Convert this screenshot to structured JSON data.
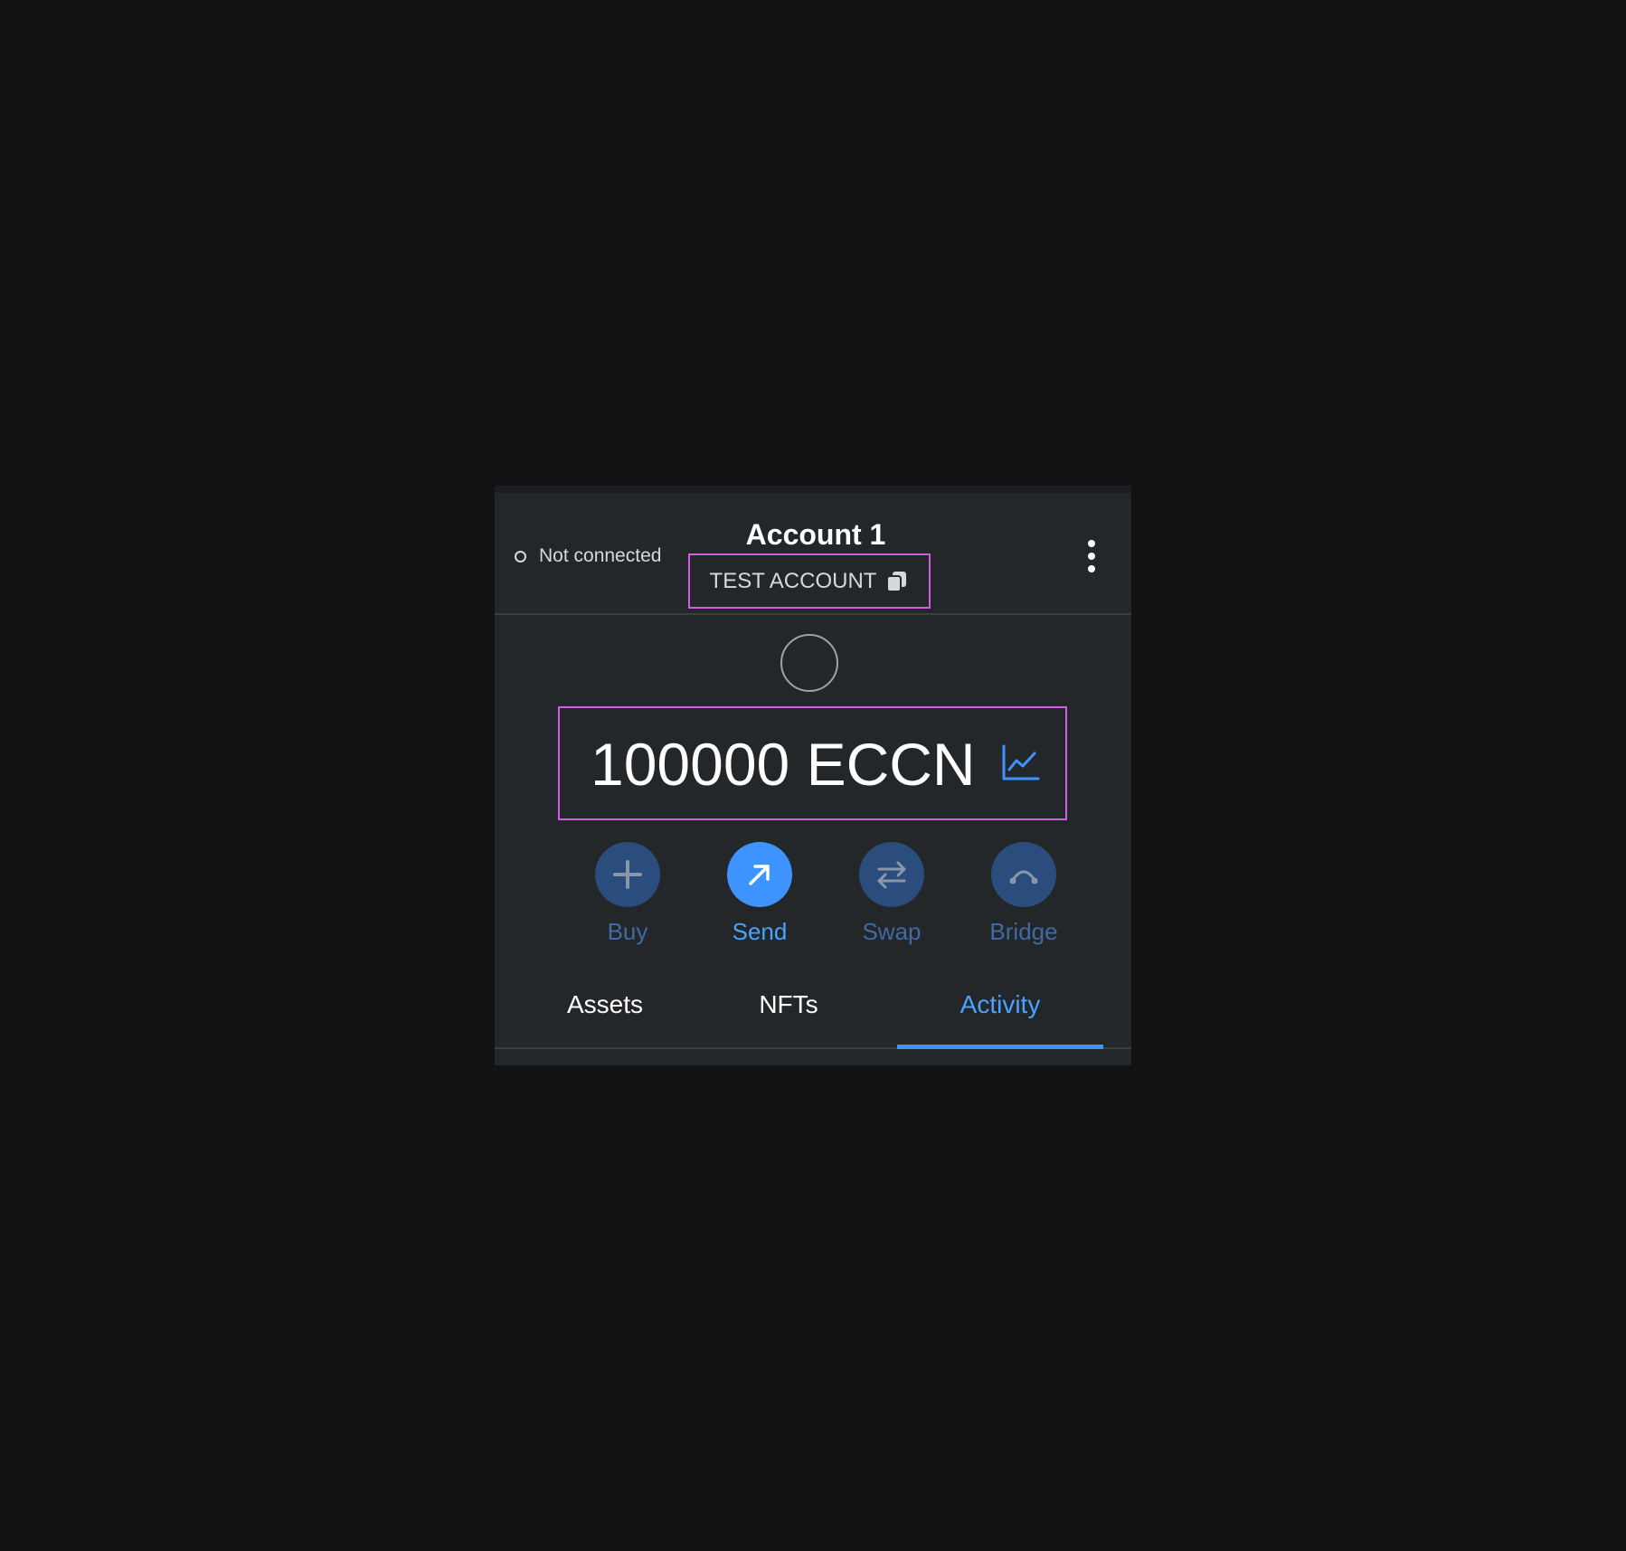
{
  "header": {
    "connection_status": "Not connected",
    "account_name": "Account 1",
    "account_label": "TEST ACCOUNT"
  },
  "balance": {
    "amount_text": "100000 ECCN"
  },
  "actions": [
    {
      "label": "Buy",
      "icon": "plus-icon",
      "state": "disabled"
    },
    {
      "label": "Send",
      "icon": "arrow-up-right-icon",
      "state": "active"
    },
    {
      "label": "Swap",
      "icon": "swap-arrows-icon",
      "state": "disabled"
    },
    {
      "label": "Bridge",
      "icon": "bridge-icon",
      "state": "disabled"
    }
  ],
  "tabs": [
    {
      "label": "Assets",
      "active": false
    },
    {
      "label": "NFTs",
      "active": false
    },
    {
      "label": "Activity",
      "active": true
    }
  ],
  "colors": {
    "background": "#111214",
    "panel": "#24272a",
    "accent": "#3e94ff",
    "highlight_border": "#d35de0",
    "disabled_button": "#2b4d7d"
  }
}
